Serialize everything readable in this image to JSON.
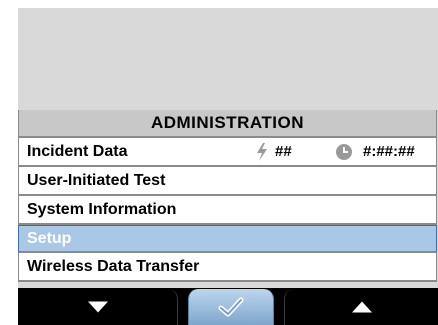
{
  "menu": {
    "title": "ADMINISTRATION",
    "items": [
      {
        "label": "Incident Data",
        "shock_count": "##",
        "elapsed_time": "#:##:##",
        "selected": false
      },
      {
        "label": "User-Initiated Test",
        "selected": false
      },
      {
        "label": "System Information",
        "selected": false
      },
      {
        "label": "Setup",
        "selected": true
      },
      {
        "label": "Wireless Data Transfer",
        "selected": false
      }
    ]
  },
  "softkeys": {
    "left": {
      "icon": "arrow-down-icon"
    },
    "center": {
      "icon": "checkmark-icon"
    },
    "right": {
      "icon": "arrow-up-icon"
    }
  },
  "colors": {
    "background": "#d9d9d9",
    "header": "#c8c8c8",
    "selection": "#a8c8e6",
    "selection_border": "#3a6fa3",
    "softkey_bar": "#000000",
    "softkey_active": "#9fbfe0"
  }
}
